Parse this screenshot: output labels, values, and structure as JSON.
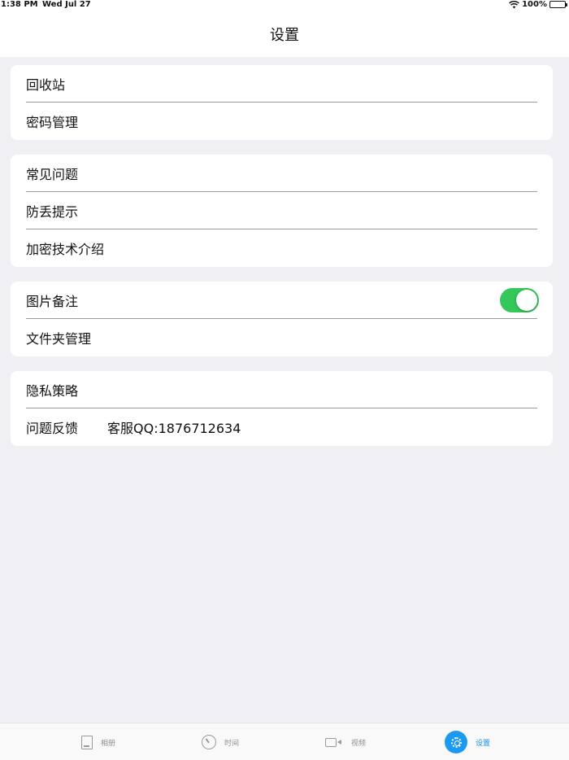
{
  "status_bar": {
    "time": "1:38 PM",
    "date": "Wed Jul 27",
    "battery": "100%"
  },
  "nav": {
    "title": "设置"
  },
  "groups": [
    {
      "rows": [
        {
          "label": "回收站"
        },
        {
          "label": "密码管理"
        }
      ]
    },
    {
      "rows": [
        {
          "label": "常见问题"
        },
        {
          "label": "防丢提示"
        },
        {
          "label": "加密技术介绍"
        }
      ]
    },
    {
      "rows": [
        {
          "label": "图片备注",
          "toggle": true
        },
        {
          "label": "文件夹管理"
        }
      ]
    },
    {
      "rows": [
        {
          "label": "隐私策略"
        },
        {
          "label": "问题反馈",
          "extra": "客服QQ:1876712634"
        }
      ]
    }
  ],
  "tab_bar": {
    "tabs": [
      {
        "label": "相册",
        "icon": "album-icon"
      },
      {
        "label": "时间",
        "icon": "clock-icon"
      },
      {
        "label": "视频",
        "icon": "video-icon"
      },
      {
        "label": "设置",
        "icon": "settings-icon",
        "active": true
      }
    ]
  },
  "colors": {
    "toggle_on": "#34c759",
    "accent": "#1a9af0",
    "background": "#efeff4"
  }
}
